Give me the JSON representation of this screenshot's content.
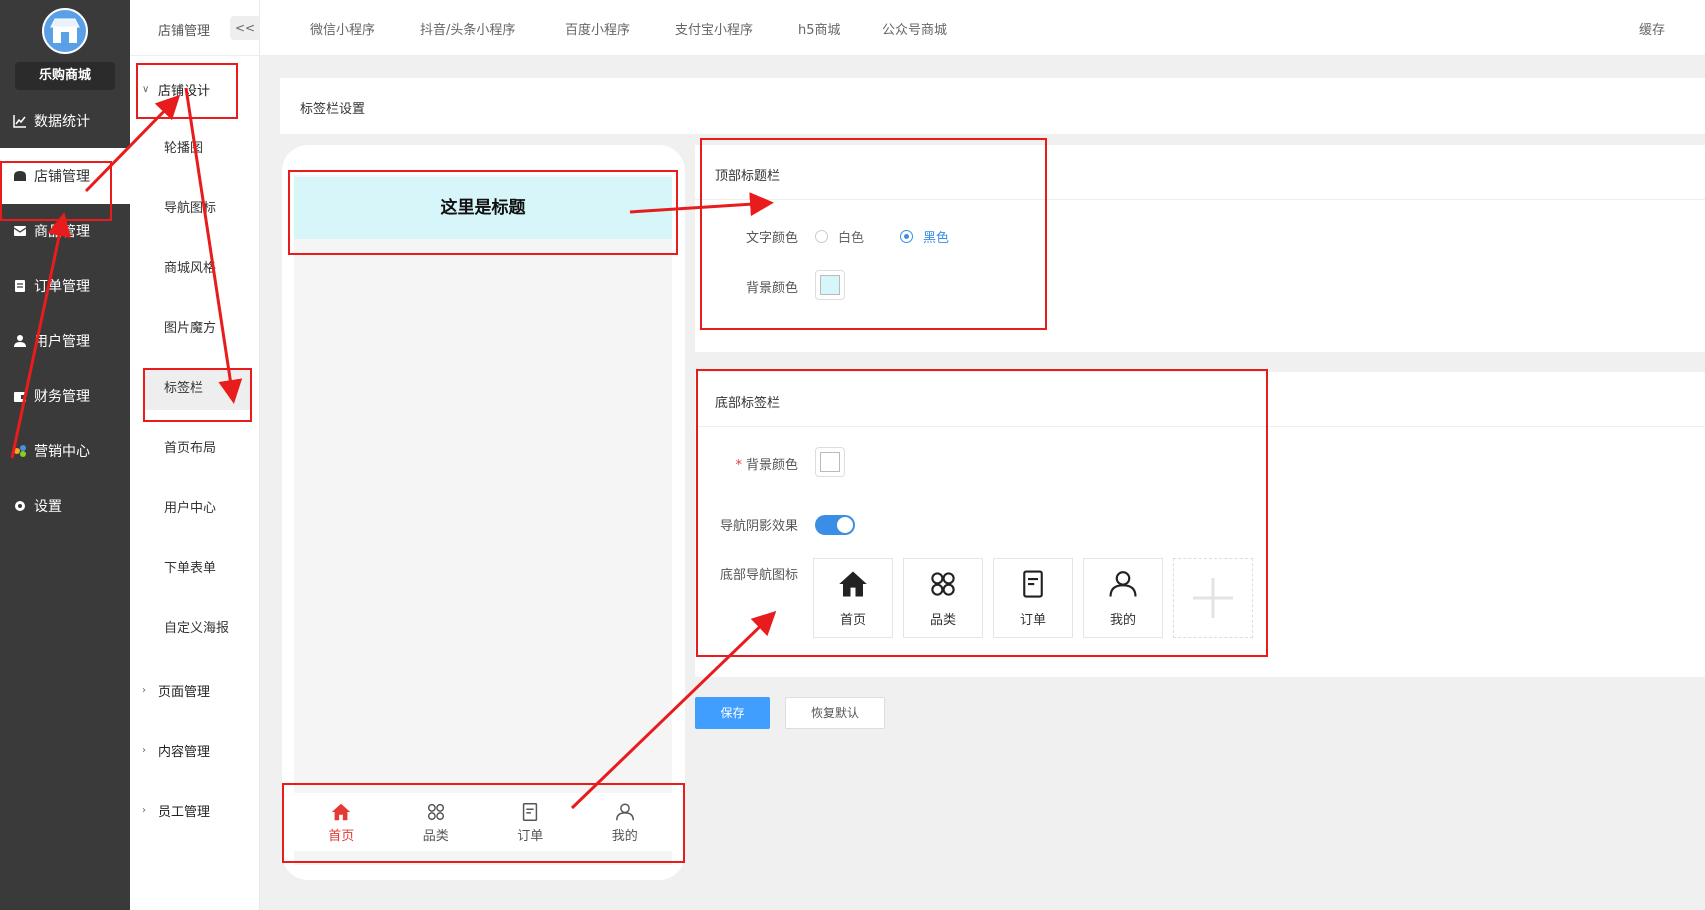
{
  "sidebar": {
    "brand": "乐购商城",
    "items": [
      {
        "label": "数据统计",
        "icon": "chart-line-icon"
      },
      {
        "label": "店铺管理",
        "icon": "store-icon"
      },
      {
        "label": "商品管理",
        "icon": "mail-icon"
      },
      {
        "label": "订单管理",
        "icon": "clipboard-icon"
      },
      {
        "label": "用户管理",
        "icon": "user-icon"
      },
      {
        "label": "财务管理",
        "icon": "wallet-icon"
      },
      {
        "label": "营销中心",
        "icon": "marketing-icon"
      },
      {
        "label": "设置",
        "icon": "gear-icon"
      }
    ]
  },
  "subnav": {
    "title": "店铺管理",
    "collapse": "<<",
    "group_open": "店铺设计",
    "items": [
      "轮播图",
      "导航图标",
      "商城风格",
      "图片魔方",
      "标签栏",
      "首页布局",
      "用户中心",
      "下单表单",
      "自定义海报"
    ],
    "groups_closed": [
      "页面管理",
      "内容管理",
      "员工管理"
    ]
  },
  "topbar": {
    "tabs": [
      "微信小程序",
      "抖音/头条小程序",
      "百度小程序",
      "支付宝小程序",
      "h5商城",
      "公众号商城"
    ],
    "cache": "缓存"
  },
  "section_title": "标签栏设置",
  "phone": {
    "title": "这里是标题",
    "tabs": [
      "首页",
      "品类",
      "订单",
      "我的"
    ]
  },
  "top_panel": {
    "title": "顶部标题栏",
    "text_color_label": "文字颜色",
    "options": [
      "白色",
      "黑色"
    ],
    "selected": "黑色",
    "bg_color_label": "背景颜色",
    "bg_color": "#d6f6fa"
  },
  "bottom_panel": {
    "title": "底部标签栏",
    "required_mark": "*",
    "bg_color_label": "背景颜色",
    "bg_color": "#ffffff",
    "shadow_label": "导航阴影效果",
    "shadow_on": true,
    "icons_label": "底部导航图标",
    "icons": [
      "首页",
      "品类",
      "订单",
      "我的"
    ]
  },
  "buttons": {
    "save": "保存",
    "reset": "恢复默认"
  },
  "colors": {
    "accent": "#409eff",
    "annotation": "#e81c1c",
    "active_tab": "#e53935"
  }
}
